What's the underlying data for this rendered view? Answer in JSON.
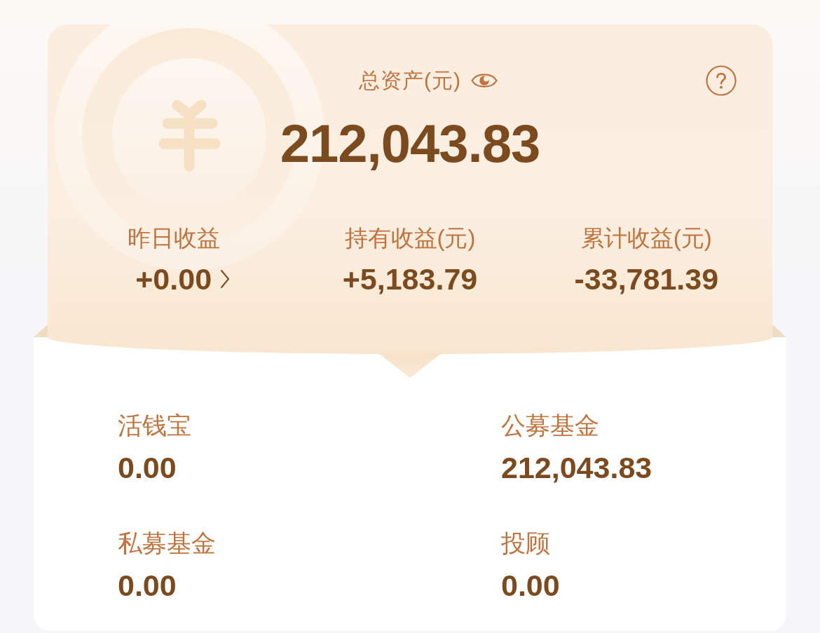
{
  "summary": {
    "title": "总资产(元)",
    "total": "212,043.83",
    "stats": [
      {
        "label": "昨日收益",
        "value": "+0.00",
        "has_detail": true
      },
      {
        "label": "持有收益(元)",
        "value": "+5,183.79",
        "has_detail": false
      },
      {
        "label": "累计收益(元)",
        "value": "-33,781.39",
        "has_detail": false
      }
    ]
  },
  "holdings": [
    {
      "label": "活钱宝",
      "value": "0.00"
    },
    {
      "label": "公募基金",
      "value": "212,043.83"
    },
    {
      "label": "私募基金",
      "value": "0.00"
    },
    {
      "label": "投顾",
      "value": "0.00"
    }
  ]
}
